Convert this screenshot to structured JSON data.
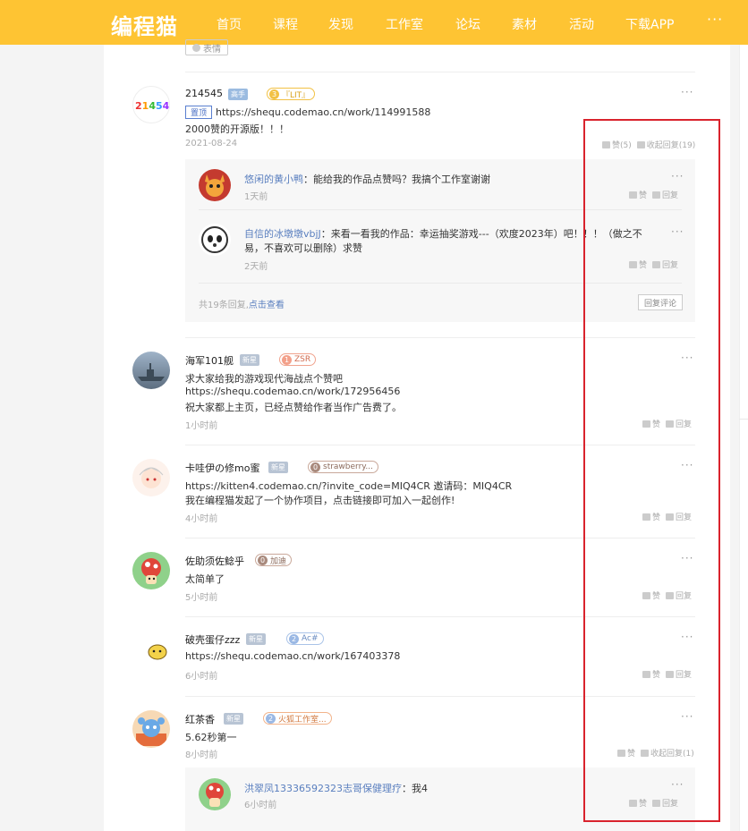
{
  "nav": {
    "logo": "编程猫",
    "items": [
      "首页",
      "课程",
      "发现",
      "工作室",
      "论坛",
      "素材",
      "活动",
      "下载APP"
    ],
    "more": "···"
  },
  "top": {
    "biaoqing": "表情",
    "faint": ""
  },
  "comments": [
    {
      "user": "214545",
      "badge": "高手",
      "tag_num": "3",
      "tag_label": "『LIT』",
      "pin": "置顶",
      "lines": [
        "https://shequ.codemao.cn/work/114991588",
        "2000赞的开源版！！！"
      ],
      "time": "2021-08-24",
      "like": "赞(5)",
      "reply": "收起回复(19)",
      "replies": [
        {
          "user": "悠闲的黄小鸭",
          "text": "：能给我的作品点赞吗？我搞个工作室谢谢",
          "time": "1天前",
          "like": "赞",
          "reply": "回复"
        },
        {
          "user": "自信的冰墩墩vbjJ",
          "text": "：来看一看我的作品：幸运抽奖游戏---（欢度2023年）吧！！！（做之不",
          "text2": "易，不喜欢可以删除）求赞",
          "time": "2天前",
          "like": "赞",
          "reply": "回复"
        }
      ],
      "reply_count": "共19条回复,",
      "reply_view": "点击查看",
      "reply_btn": "回复评论"
    },
    {
      "user": "海军101舰",
      "badge": "新星",
      "tag_num": "1",
      "tag_label": "ZSR",
      "lines": [
        "求大家给我的游戏现代海战点个赞吧",
        "https://shequ.codemao.cn/work/172956456",
        "祝大家都上主页，已经点赞给作者当作广告费了。"
      ],
      "time": "1小时前",
      "like": "赞",
      "reply": "回复"
    },
    {
      "user": "卡哇伊の修mo蜜",
      "badge": "新星",
      "tag_num": "0",
      "tag_label": "strawberry...",
      "lines": [
        "https://kitten4.codemao.cn/?invite_code=MIQ4CR   邀请码：MIQ4CR",
        "我在编程猫发起了一个协作项目，点击链接即可加入一起创作!"
      ],
      "time": "4小时前",
      "like": "赞",
      "reply": "回复"
    },
    {
      "user": "佐助须佐鲶乎",
      "tag_num": "0",
      "tag_label": "加迪",
      "lines": [
        "太简单了"
      ],
      "time": "5小时前",
      "like": "赞",
      "reply": "回复"
    },
    {
      "user": "破壳蛋仔zzz",
      "badge": "新星",
      "tag_num": "2",
      "tag_label": "Ac#",
      "lines": [
        "https://shequ.codemao.cn/work/167403378"
      ],
      "time": "6小时前",
      "like": "赞",
      "reply": "回复"
    },
    {
      "user": "红茶香",
      "badge": "新星",
      "tag_num": "2",
      "tag_label": "火狐工作室...",
      "lines": [
        "5.62秒第一"
      ],
      "time": "8小时前",
      "like": "赞",
      "reply": "收起回复(1)",
      "replies": [
        {
          "user": "洪翠凤13336592323志哥保健理疗",
          "text": "：我4",
          "time": "6小时前",
          "like": "赞",
          "reply": "回复"
        }
      ]
    }
  ],
  "colors": {
    "brand": "#fec433",
    "link": "#5a7fbf",
    "highlight": "#d9232d"
  }
}
